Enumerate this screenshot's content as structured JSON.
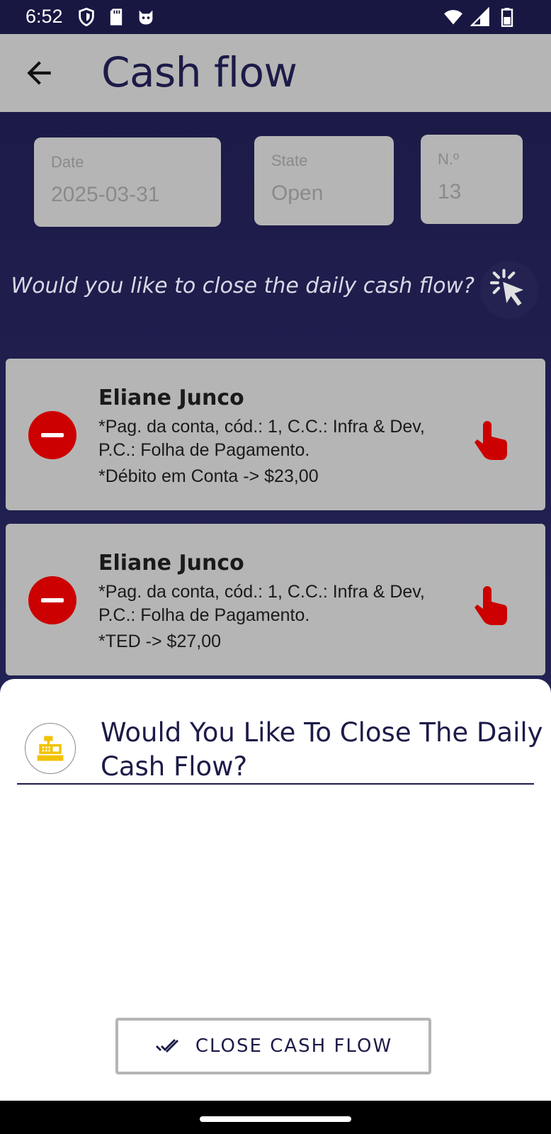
{
  "status_bar": {
    "time": "6:52",
    "left_icons": [
      "shield-icon",
      "sd-card-icon",
      "cat-face-icon"
    ],
    "right_icons": [
      "wifi-icon",
      "signal-icon",
      "battery-icon"
    ]
  },
  "app_bar": {
    "title": "Cash flow",
    "back_icon": "arrow-left-icon"
  },
  "fields": {
    "date": {
      "label": "Date",
      "value": "2025-03-31"
    },
    "state": {
      "label": "State",
      "value": "Open"
    },
    "number": {
      "label": "N.º",
      "value": "13"
    }
  },
  "prompt": {
    "text": "Would you like to close the daily cash flow?",
    "action_icon": "tap-click-icon"
  },
  "cards": [
    {
      "name": "Eliane Junco",
      "description": "*Pag. da conta, cód.: 1, C.C.: Infra & Dev, P.C.: Folha de Pagamento.",
      "amount": "*Débito em Conta ->  $23,00"
    },
    {
      "name": "Eliane Junco",
      "description": "*Pag. da conta, cód.: 1, C.C.: Infra & Dev, P.C.: Folha de Pagamento.",
      "amount": "*TED ->  $27,00"
    }
  ],
  "sheet": {
    "title_line1": "Would You Like To Close The Daily",
    "title_line2": "Cash Flow?",
    "icon": "cash-register-icon",
    "button_label": "CLOSE CASH FLOW",
    "button_icon": "double-check-icon"
  },
  "colors": {
    "navy": "#1c1b48",
    "surface_gray": "#b5b5b5",
    "danger_red": "#cc0000",
    "register_yellow": "#f2c200"
  }
}
